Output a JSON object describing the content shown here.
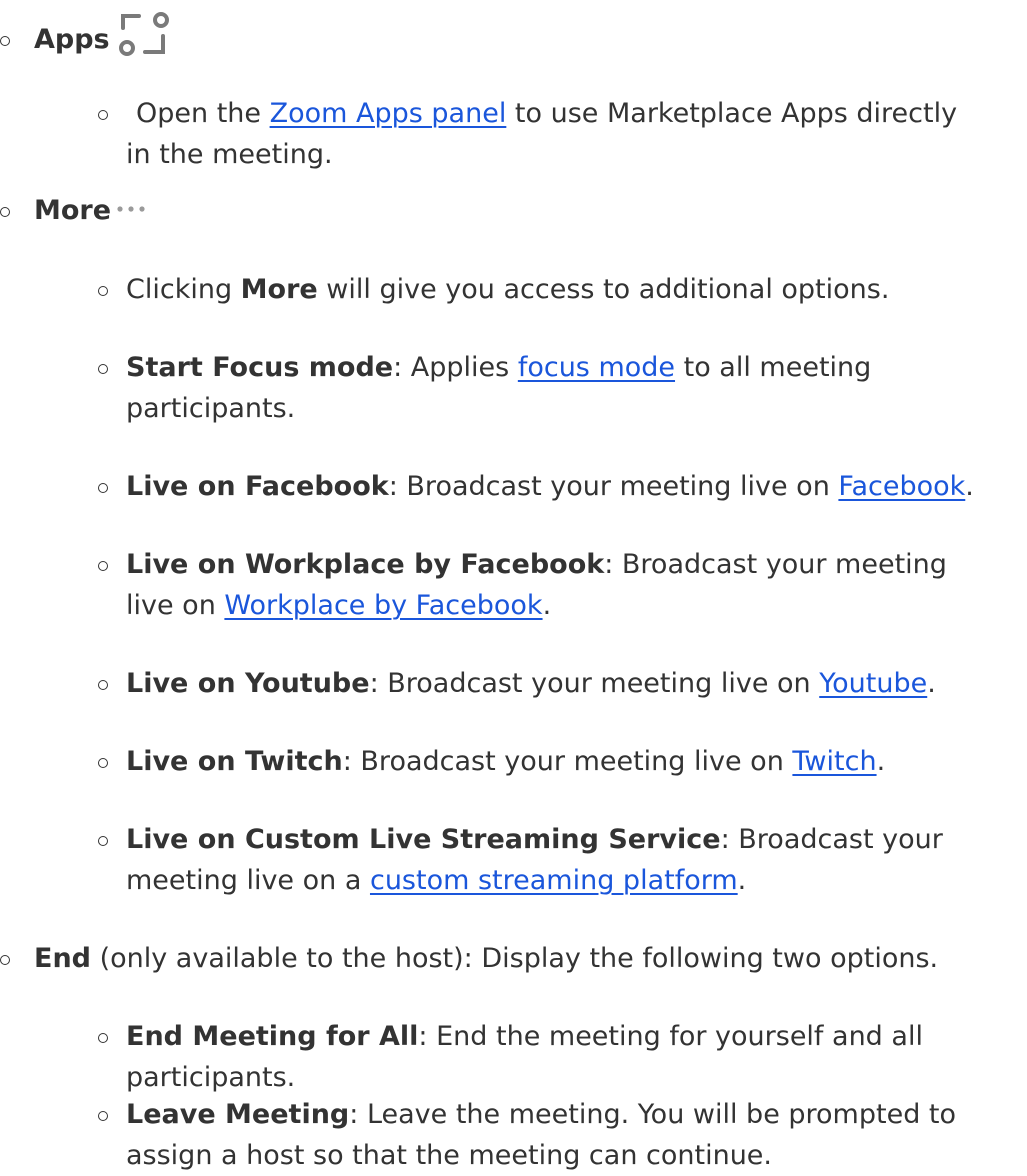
{
  "items": {
    "apps": {
      "title": "Apps",
      "icon": "apps-icon"
    },
    "apps_desc": {
      "pre": "Open the ",
      "link": "Zoom Apps panel",
      "post": " to use Marketplace Apps directly",
      "line2": "in the meeting."
    },
    "more": {
      "title": "More",
      "icon": "more-dots-icon"
    },
    "more_desc": {
      "pre": "Clicking ",
      "bold": "More",
      "post": " will give you access to additional options."
    },
    "focus": {
      "bold": "Start Focus mode",
      "pre": ": Applies ",
      "link": "focus mode",
      "post": " to all meeting",
      "line2": "participants."
    },
    "facebook": {
      "bold": "Live on Facebook",
      "pre": ": Broadcast your meeting live on ",
      "link": "Facebook",
      "post": "."
    },
    "workplace": {
      "bold": "Live on Workplace by Facebook",
      "pre": ": Broadcast your meeting",
      "line2_pre": "live on ",
      "link": "Workplace by Facebook",
      "post": "."
    },
    "youtube": {
      "bold": "Live on Youtube",
      "pre": ": Broadcast your meeting live on ",
      "link": "Youtube",
      "post": "."
    },
    "twitch": {
      "bold": "Live on Twitch",
      "pre": ": Broadcast your meeting live on ",
      "link": "Twitch",
      "post": "."
    },
    "custom": {
      "bold": "Live on Custom Live Streaming Service",
      "pre": ": Broadcast your",
      "line2_pre": "meeting live on a ",
      "link": "custom streaming platform",
      "post": "."
    },
    "end": {
      "bold": "End",
      "post": " (only available to the host): Display the following two options."
    },
    "end_all": {
      "bold": "End Meeting for All",
      "post": ": End the meeting for yourself and all",
      "line2": "participants."
    },
    "leave": {
      "bold": "Leave Meeting",
      "post": ": Leave the meeting. You will be prompted to",
      "line2": "assign a host so that the meeting can continue."
    }
  },
  "colors": {
    "text": "#333333",
    "link": "#1a56db",
    "icon": "#7a7a7a"
  }
}
